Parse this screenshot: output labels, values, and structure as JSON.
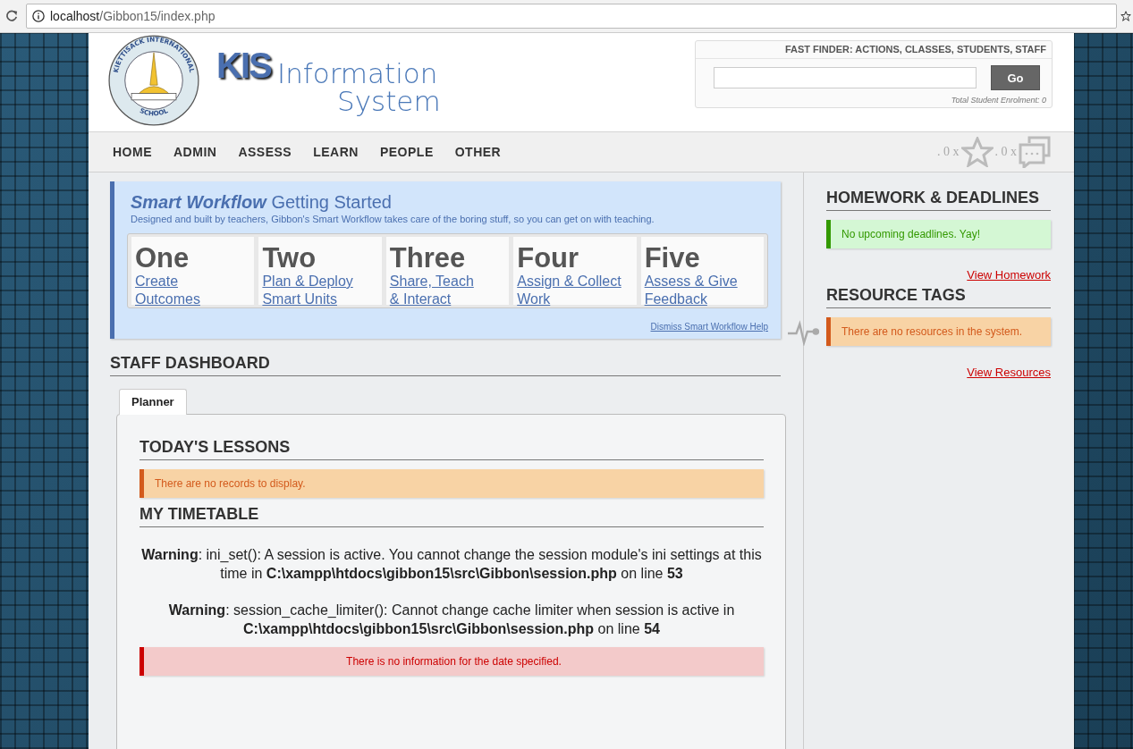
{
  "browser": {
    "url_host": "localhost",
    "url_path": "/Gibbon15/index.php"
  },
  "header": {
    "logo": {
      "ring_top": "KIETTISACK INTERNATIONAL",
      "ring_bottom": "SCHOOL"
    },
    "brand": "KIS",
    "title_lines": [
      "Information",
      "System"
    ]
  },
  "fast_finder": {
    "title": "FAST FINDER: ACTIONS, CLASSES, STUDENTS, STAFF",
    "button": "Go",
    "enrolment": "Total Student Enrolment: 0"
  },
  "nav": {
    "items": [
      "HOME",
      "ADMIN",
      "ASSESS",
      "LEARN",
      "PEOPLE",
      "OTHER"
    ],
    "counters": [
      {
        "kind": "likes",
        "count": ". 0 x"
      },
      {
        "kind": "messages",
        "count": ". 0 x"
      }
    ]
  },
  "workflow": {
    "title_em": "Smart Workflow",
    "title": "Getting Started",
    "subtitle": "Designed and built by teachers, Gibbon's Smart Workflow takes care of the boring stuff, so you can get on with teaching.",
    "steps": [
      {
        "number": "One",
        "link_lines": [
          "Create",
          "Outcomes"
        ]
      },
      {
        "number": "Two",
        "link_lines": [
          "Plan & Deploy",
          "Smart Units"
        ]
      },
      {
        "number": "Three",
        "link_lines": [
          "Share, Teach",
          "& Interact"
        ]
      },
      {
        "number": "Four",
        "link_lines": [
          "Assign & Collect",
          "Work"
        ]
      },
      {
        "number": "Five",
        "link_lines": [
          "Assess & Give",
          "Feedback"
        ]
      }
    ],
    "dismiss": "Dismiss Smart Workflow Help"
  },
  "dashboard": {
    "heading": "STAFF DASHBOARD",
    "tabs": [
      {
        "label": "Planner",
        "selected": true
      }
    ],
    "sections": [
      {
        "heading": "TODAY'S LESSONS",
        "message": {
          "kind": "warning",
          "text": "There are no records to display."
        }
      },
      {
        "heading": "MY TIMETABLE",
        "warnings": [
          "**Warning**: ini_set(): A session is active. You cannot change the session module's ini settings at this time in **C:\\xampp\\htdocs\\gibbon15\\src\\Gibbon\\session.php** on line **53**",
          "**Warning**: session_cache_limiter(): Cannot change cache limiter when session is active in **C:\\xampp\\htdocs\\gibbon15\\src\\Gibbon\\session.php** on line **54**"
        ],
        "message": {
          "kind": "error",
          "text": "There is no information for the date specified."
        }
      }
    ]
  },
  "sidebar": {
    "sections": [
      {
        "heading": "HOMEWORK & DEADLINES",
        "message": {
          "kind": "success",
          "text": "No upcoming deadlines. Yay!"
        },
        "link": "View Homework"
      },
      {
        "heading": "RESOURCE TAGS",
        "message": {
          "kind": "warning",
          "text": "There are no resources in the system."
        },
        "link": "View Resources"
      }
    ]
  }
}
